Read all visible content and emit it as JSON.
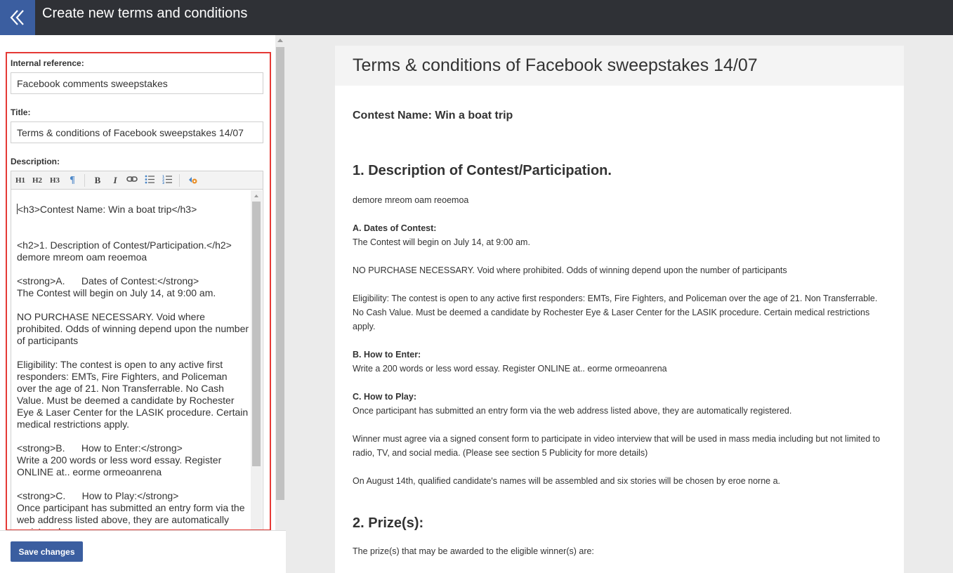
{
  "header": {
    "title": "Create new terms and conditions",
    "back_icon": "double-chevron-left-icon"
  },
  "form": {
    "internal_reference_label": "Internal reference:",
    "internal_reference_value": "Facebook comments sweepstakes",
    "title_label": "Title:",
    "title_value": "Terms & conditions of Facebook sweepstakes 14/07",
    "description_label": "Description:",
    "toolbar": {
      "h1": "H1",
      "h2": "H2",
      "h3": "H3",
      "paragraph_icon": "paragraph-icon",
      "bold": "B",
      "italic": "I",
      "link_icon": "link-icon",
      "bullet_list_icon": "bullet-list-icon",
      "numbered_list_icon": "numbered-list-icon",
      "source_icon": "source-edit-icon"
    },
    "editor_lines": [
      "<h3>Contest Name: Win a boat trip</h3>",
      "<h2>1. Description of Contest/Participation.</h2>",
      "demore mreom oam reoemoa",
      "<strong>A.      Dates of Contest:</strong>",
      "The Contest will begin on July 14, at 9:00 am.",
      "NO PURCHASE NECESSARY. Void where prohibited. Odds of winning depend upon the number of participants",
      "Eligibility: The contest is open to any active first responders: EMTs, Fire Fighters, and Policeman over the age of 21. Non Transferrable. No Cash Value. Must be deemed a candidate by Rochester Eye & Laser Center for the LASIK procedure. Certain medical restrictions apply.",
      "<strong>B.      How to Enter:</strong>",
      "Write a 200 words or less word essay. Register ONLINE at.. eorme ormeoanrena",
      "<strong>C.      How to Play:</strong>",
      "Once participant has submitted an entry form via the web address listed above, they are automatically registered."
    ],
    "save_label": "Save changes"
  },
  "preview": {
    "title": "Terms & conditions of Facebook sweepstakes 14/07",
    "contest_name": "Contest Name: Win a boat trip",
    "section1_heading": "1. Description of Contest/Participation.",
    "section1_text": "demore mreom oam reoemoa",
    "dates_heading": "A. Dates of Contest:",
    "dates_text": "The Contest will begin on July 14, at 9:00 am.",
    "no_purchase": "NO PURCHASE NECESSARY. Void where prohibited. Odds of winning depend upon the number of participants",
    "eligibility": "Eligibility: The contest is open to any active first responders: EMTs, Fire Fighters, and Policeman over the age of 21. Non Transferrable. No Cash Value. Must be deemed a candidate by Rochester Eye & Laser Center for the LASIK procedure. Certain medical restrictions apply.",
    "enter_heading": "B. How to Enter:",
    "enter_text": "Write a 200 words or less word essay. Register ONLINE at.. eorme ormeoanrena",
    "play_heading": "C. How to Play:",
    "play_text": "Once participant has submitted an entry form via the web address listed above, they are automatically registered.",
    "winner_text": "Winner must agree via a signed consent form to participate in video interview that will be used in mass media including but not limited to radio, TV, and social media. (Please see section 5 Publicity for more details)",
    "august_text": "On August 14th, qualified candidate's names will be assembled and six stories will be chosen by eroe norne a.",
    "section2_heading": "2. Prize(s):",
    "prizes_text": "The prize(s) that may be awarded to the eligible winner(s) are:"
  },
  "colors": {
    "topbar": "#2f3136",
    "accent": "#3b5ea0",
    "highlight_border": "#e53935"
  }
}
